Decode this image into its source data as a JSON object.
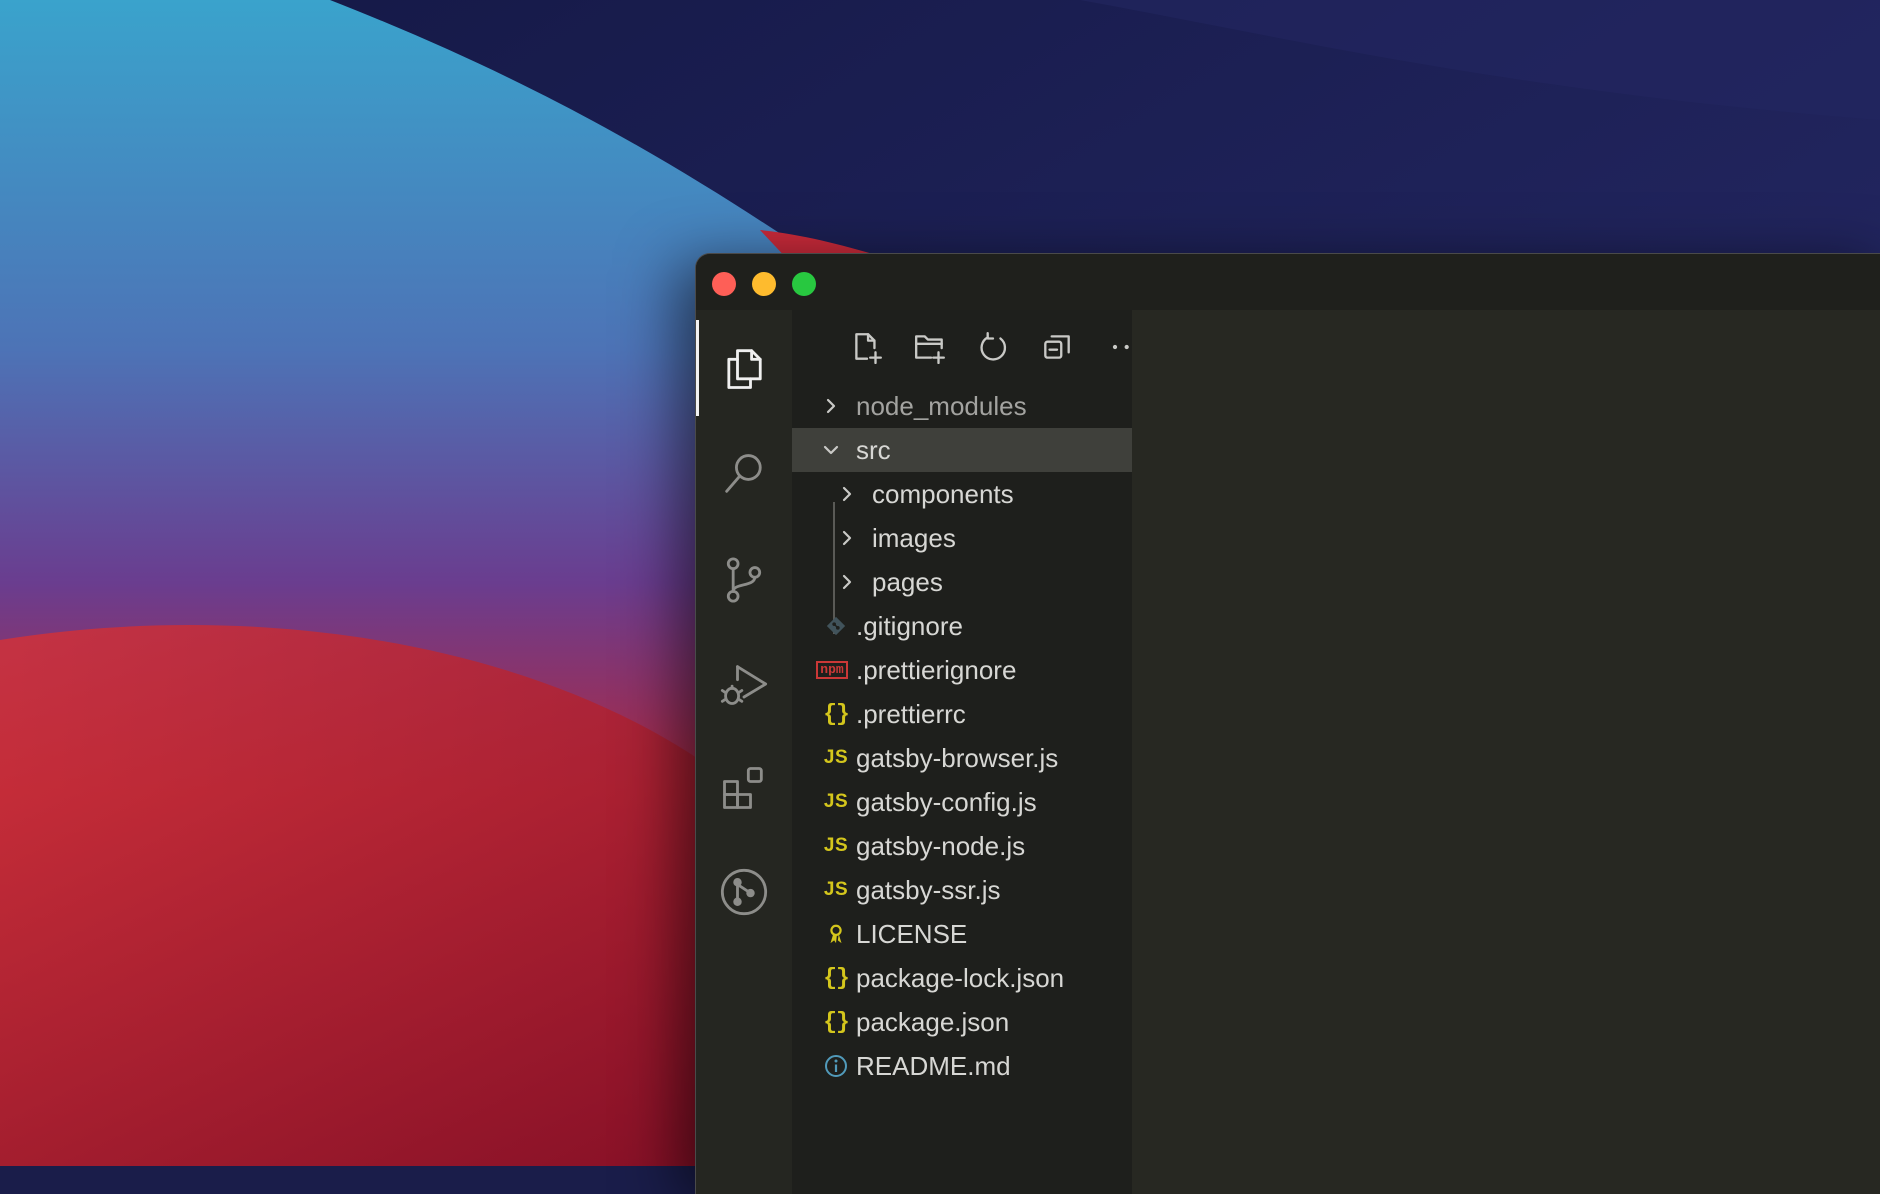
{
  "colors": {
    "window_bg": "#252621",
    "sidebar_bg": "#1e1f1c",
    "editor_bg": "#272822",
    "selection_bg": "#3f403b",
    "js_icon": "#d4c61c",
    "npm_icon": "#cb3837",
    "info_icon": "#519aba",
    "traffic_close": "#fe5f57",
    "traffic_minimize": "#febb2e",
    "traffic_maximize": "#28c840"
  },
  "window": {
    "traffic_lights": [
      "close",
      "minimize",
      "maximize"
    ]
  },
  "activity_bar": {
    "items": [
      {
        "name": "explorer",
        "icon": "files-icon",
        "active": true
      },
      {
        "name": "search",
        "icon": "search-icon",
        "active": false
      },
      {
        "name": "source-control",
        "icon": "source-control-icon",
        "active": false
      },
      {
        "name": "run-and-debug",
        "icon": "run-debug-icon",
        "active": false
      },
      {
        "name": "extensions",
        "icon": "extensions-icon",
        "active": false
      },
      {
        "name": "git-graph",
        "icon": "git-graph-icon",
        "active": false
      }
    ]
  },
  "explorer": {
    "toolbar": [
      {
        "name": "new-file",
        "icon": "new-file-icon"
      },
      {
        "name": "new-folder",
        "icon": "new-folder-icon"
      },
      {
        "name": "refresh",
        "icon": "refresh-icon"
      },
      {
        "name": "collapse-all",
        "icon": "collapse-all-icon"
      },
      {
        "name": "more-actions",
        "icon": "ellipsis-icon"
      }
    ],
    "tree": [
      {
        "label": "node_modules",
        "type": "folder",
        "expanded": false,
        "depth": 0,
        "dimmed": true
      },
      {
        "label": "src",
        "type": "folder",
        "expanded": true,
        "depth": 0,
        "selected": true
      },
      {
        "label": "components",
        "type": "folder",
        "expanded": false,
        "depth": 1
      },
      {
        "label": "images",
        "type": "folder",
        "expanded": false,
        "depth": 1
      },
      {
        "label": "pages",
        "type": "folder",
        "expanded": false,
        "depth": 1
      },
      {
        "label": ".gitignore",
        "type": "file",
        "icon": "git-icon",
        "depth": 0
      },
      {
        "label": ".prettierignore",
        "type": "file",
        "icon": "npm-icon",
        "icon_text": "npm",
        "depth": 0
      },
      {
        "label": ".prettierrc",
        "type": "file",
        "icon": "braces-icon",
        "icon_text": "{}",
        "depth": 0
      },
      {
        "label": "gatsby-browser.js",
        "type": "file",
        "icon": "js-icon",
        "icon_text": "JS",
        "depth": 0
      },
      {
        "label": "gatsby-config.js",
        "type": "file",
        "icon": "js-icon",
        "icon_text": "JS",
        "depth": 0
      },
      {
        "label": "gatsby-node.js",
        "type": "file",
        "icon": "js-icon",
        "icon_text": "JS",
        "depth": 0
      },
      {
        "label": "gatsby-ssr.js",
        "type": "file",
        "icon": "js-icon",
        "icon_text": "JS",
        "depth": 0
      },
      {
        "label": "LICENSE",
        "type": "file",
        "icon": "license-icon",
        "depth": 0
      },
      {
        "label": "package-lock.json",
        "type": "file",
        "icon": "braces-icon",
        "icon_text": "{}",
        "depth": 0
      },
      {
        "label": "package.json",
        "type": "file",
        "icon": "braces-icon",
        "icon_text": "{}",
        "depth": 0
      },
      {
        "label": "README.md",
        "type": "file",
        "icon": "info-icon",
        "depth": 0
      }
    ]
  }
}
